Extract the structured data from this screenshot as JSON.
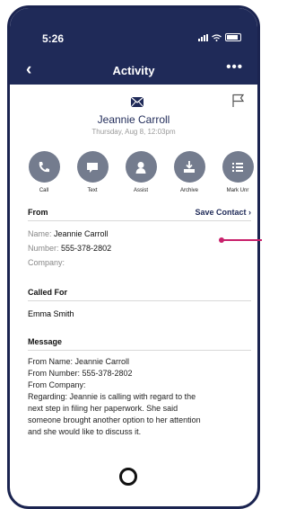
{
  "status_bar": {
    "time": "5:26"
  },
  "navbar": {
    "title": "Activity",
    "back_icon": "‹",
    "more_icon": "•••"
  },
  "contact": {
    "name": "Jeannie Carroll",
    "date": "Thursday, Aug 8, 12:03pm"
  },
  "actions": [
    {
      "label": "Call",
      "icon": "phone-icon"
    },
    {
      "label": "Text",
      "icon": "chat-icon"
    },
    {
      "label": "Assist",
      "icon": "assist-icon"
    },
    {
      "label": "Archive",
      "icon": "archive-icon"
    },
    {
      "label": "Mark Unr",
      "icon": "list-icon"
    }
  ],
  "from": {
    "heading": "From",
    "save_label": "Save Contact ›",
    "name_label": "Name:",
    "name_value": "Jeannie Carroll",
    "number_label": "Number:",
    "number_value": "555-378-2802",
    "company_label": "Company:"
  },
  "called_for": {
    "heading": "Called For",
    "value": "Emma Smith"
  },
  "message": {
    "heading": "Message",
    "lines": [
      "From Name: Jeannie Carroll",
      "From Number: 555-378-2802",
      "From Company:",
      "Regarding: Jeannie is calling with regard to the",
      "next step in filing her paperwork. She said",
      "someone brought another option to her attention",
      "and she would like to discuss it."
    ]
  },
  "colors": {
    "primary": "#1f2a58",
    "icon_gray": "#747c8e",
    "pointer": "#c8206b"
  }
}
